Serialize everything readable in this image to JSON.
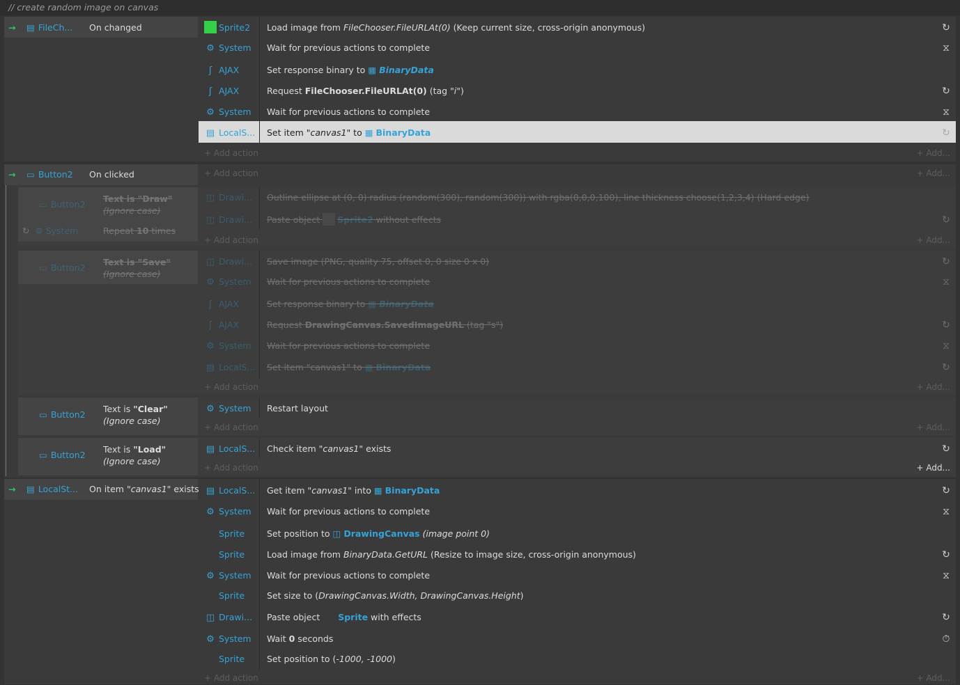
{
  "comment": "//   create random image on canvas",
  "icons": {
    "arrow": "→",
    "gear": "⚙",
    "ajax": "ʃ",
    "storage": "▤",
    "canvas": "◫",
    "clock": "◷",
    "wait": "⧖",
    "timer": "⏱",
    "loop": "↻",
    "grid": "▦",
    "button": "▭",
    "file": "▤"
  },
  "colors": {
    "bg": "#333333",
    "accent": "#36a3d6",
    "green": "#34d04a",
    "arrow": "#2ec76a",
    "selected": "#dadada"
  },
  "add_action": "+ Add action",
  "add_short": "+ Add...",
  "block1": {
    "obj": "FileCh...",
    "cond": "On changed",
    "actions": [
      {
        "obj": "Sprite2",
        "t1": "Load image from ",
        "t2": "FileChooser.FileURLAt(0)",
        "t3": " (Keep current size, cross-origin anonymous)"
      },
      {
        "obj": "System",
        "text": "Wait for previous actions to complete"
      },
      {
        "obj": "AJAX",
        "t1": "Set response binary to ",
        "var": "BinaryData"
      },
      {
        "obj": "AJAX",
        "t1": "Request ",
        "b": "FileChooser.FileURLAt(0)",
        "t2": " (tag ",
        "i": "\"i\"",
        "t3": ")"
      },
      {
        "obj": "System",
        "text": "Wait for previous actions to complete"
      },
      {
        "obj": "LocalS...",
        "t1": "Set item ",
        "i": "\"canvas1\"",
        "t2": " to ",
        "var": "BinaryData"
      }
    ]
  },
  "block2": {
    "obj": "Button2",
    "cond": "On clicked"
  },
  "sub_draw": {
    "obj": "Button2",
    "cond_b": "Text is \"Draw\"",
    "cond_i": "(Ignore case)",
    "obj2": "System",
    "cond2_a": "Repeat ",
    "cond2_b": "10",
    "cond2_c": " times",
    "actions": [
      {
        "obj": "Drawi...",
        "text": "Outline ellipse at (0, 0) radius (random(300), random(300)) with rgba(0,0,0,100), line thickness choose(1,2,3,4) (Hard edge)"
      },
      {
        "obj": "Drawi...",
        "t1": "Paste object ",
        "var": "Sprite2",
        "t2": " without effects"
      }
    ]
  },
  "sub_save": {
    "obj": "Button2",
    "cond_b": "Text is \"Save\"",
    "cond_i": "(Ignore case)",
    "actions": [
      {
        "obj": "Drawi...",
        "text": "Save image (PNG, quality 75, offset 0, 0 size 0 x 0)"
      },
      {
        "obj": "System",
        "text": "Wait for previous actions to complete"
      },
      {
        "obj": "AJAX",
        "t1": "Set response binary to ",
        "var": "BinaryData"
      },
      {
        "obj": "AJAX",
        "t1": "Request ",
        "b": "DrawingCanvas.SavedImageURL",
        "t2": " (tag \"s\")"
      },
      {
        "obj": "System",
        "text": "Wait for previous actions to complete"
      },
      {
        "obj": "LocalS...",
        "t1": "Set item \"canvas1\" to ",
        "var": "BinaryData"
      }
    ]
  },
  "sub_clear": {
    "obj": "Button2",
    "cond_a": "Text is ",
    "cond_b": "\"Clear\"",
    "cond_i": "(Ignore case)",
    "actions": [
      {
        "obj": "System",
        "text": "Restart layout"
      }
    ]
  },
  "sub_load": {
    "obj": "Button2",
    "cond_a": "Text is ",
    "cond_b": "\"Load\"",
    "cond_i": "(Ignore case)",
    "actions": [
      {
        "obj": "LocalS...",
        "t1": "Check item ",
        "i": "\"canvas1\"",
        "t2": " exists"
      }
    ]
  },
  "block3": {
    "obj": "LocalSt...",
    "cond_a": "On item ",
    "cond_i": "\"canvas1\"",
    "cond_c": " exists",
    "actions": [
      {
        "obj": "LocalS...",
        "t1": "Get item ",
        "i": "\"canvas1\"",
        "t2": " into ",
        "var": "BinaryData"
      },
      {
        "obj": "System",
        "text": "Wait for previous actions to complete"
      },
      {
        "obj": "Sprite",
        "t1": "Set position to ",
        "var": "DrawingCanvas",
        "i": " (image point 0)"
      },
      {
        "obj": "Sprite",
        "t1": "Load image from ",
        "i": "BinaryData.GetURL",
        "t2": " (Resize to image size, cross-origin anonymous)"
      },
      {
        "obj": "System",
        "text": "Wait for previous actions to complete"
      },
      {
        "obj": "Sprite",
        "t1": "Set size to (",
        "i": "DrawingCanvas.Width, DrawingCanvas.Height",
        "t2": ")"
      },
      {
        "obj": "Drawi...",
        "t1": "Paste object ",
        "var": "Sprite",
        "t2": " with effects"
      },
      {
        "obj": "System",
        "t1": "Wait ",
        "b": "0",
        "t2": " seconds"
      },
      {
        "obj": "Sprite",
        "t1": "Set position to (",
        "i": "-1000, -1000",
        "t2": ")"
      }
    ]
  }
}
